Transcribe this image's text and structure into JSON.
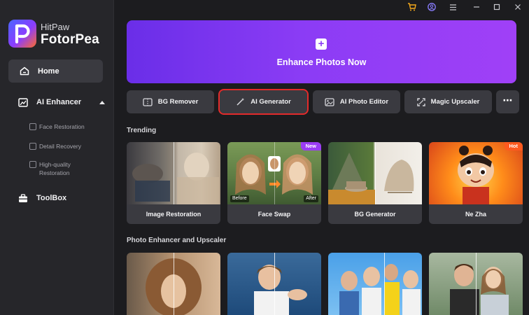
{
  "brand": {
    "small": "HitPaw",
    "big": "FotorPea"
  },
  "sidebar": {
    "home": "Home",
    "ai_enhancer": "AI Enhancer",
    "sub_items": [
      "Face Restoration",
      "Detail Recovery",
      "High-quality Restoration"
    ],
    "toolbox": "ToolBox"
  },
  "titlebar": {
    "icons": [
      "cart-icon",
      "user-icon",
      "menu-icon",
      "minimize-icon",
      "maximize-icon",
      "close-icon"
    ]
  },
  "banner": {
    "label": "Enhance Photos Now"
  },
  "tools": [
    {
      "label": "BG Remover"
    },
    {
      "label": "AI Generator",
      "selected": true
    },
    {
      "label": "AI Photo Editor"
    },
    {
      "label": "Magic Upscaler"
    }
  ],
  "trending": {
    "title": "Trending",
    "cards": [
      {
        "label": "Image Restoration"
      },
      {
        "label": "Face Swap",
        "badge": "New",
        "before": "Before",
        "after": "After"
      },
      {
        "label": "BG Generator"
      },
      {
        "label": "Ne Zha",
        "badge": "Hot"
      }
    ]
  },
  "upscaler": {
    "title": "Photo Enhancer and Upscaler"
  },
  "colors": {
    "accent_purple": "#8b3cf5",
    "selection_red": "#e32b2b",
    "badge_new": "#9b3cf5",
    "badge_hot": "#ff5a1f"
  }
}
